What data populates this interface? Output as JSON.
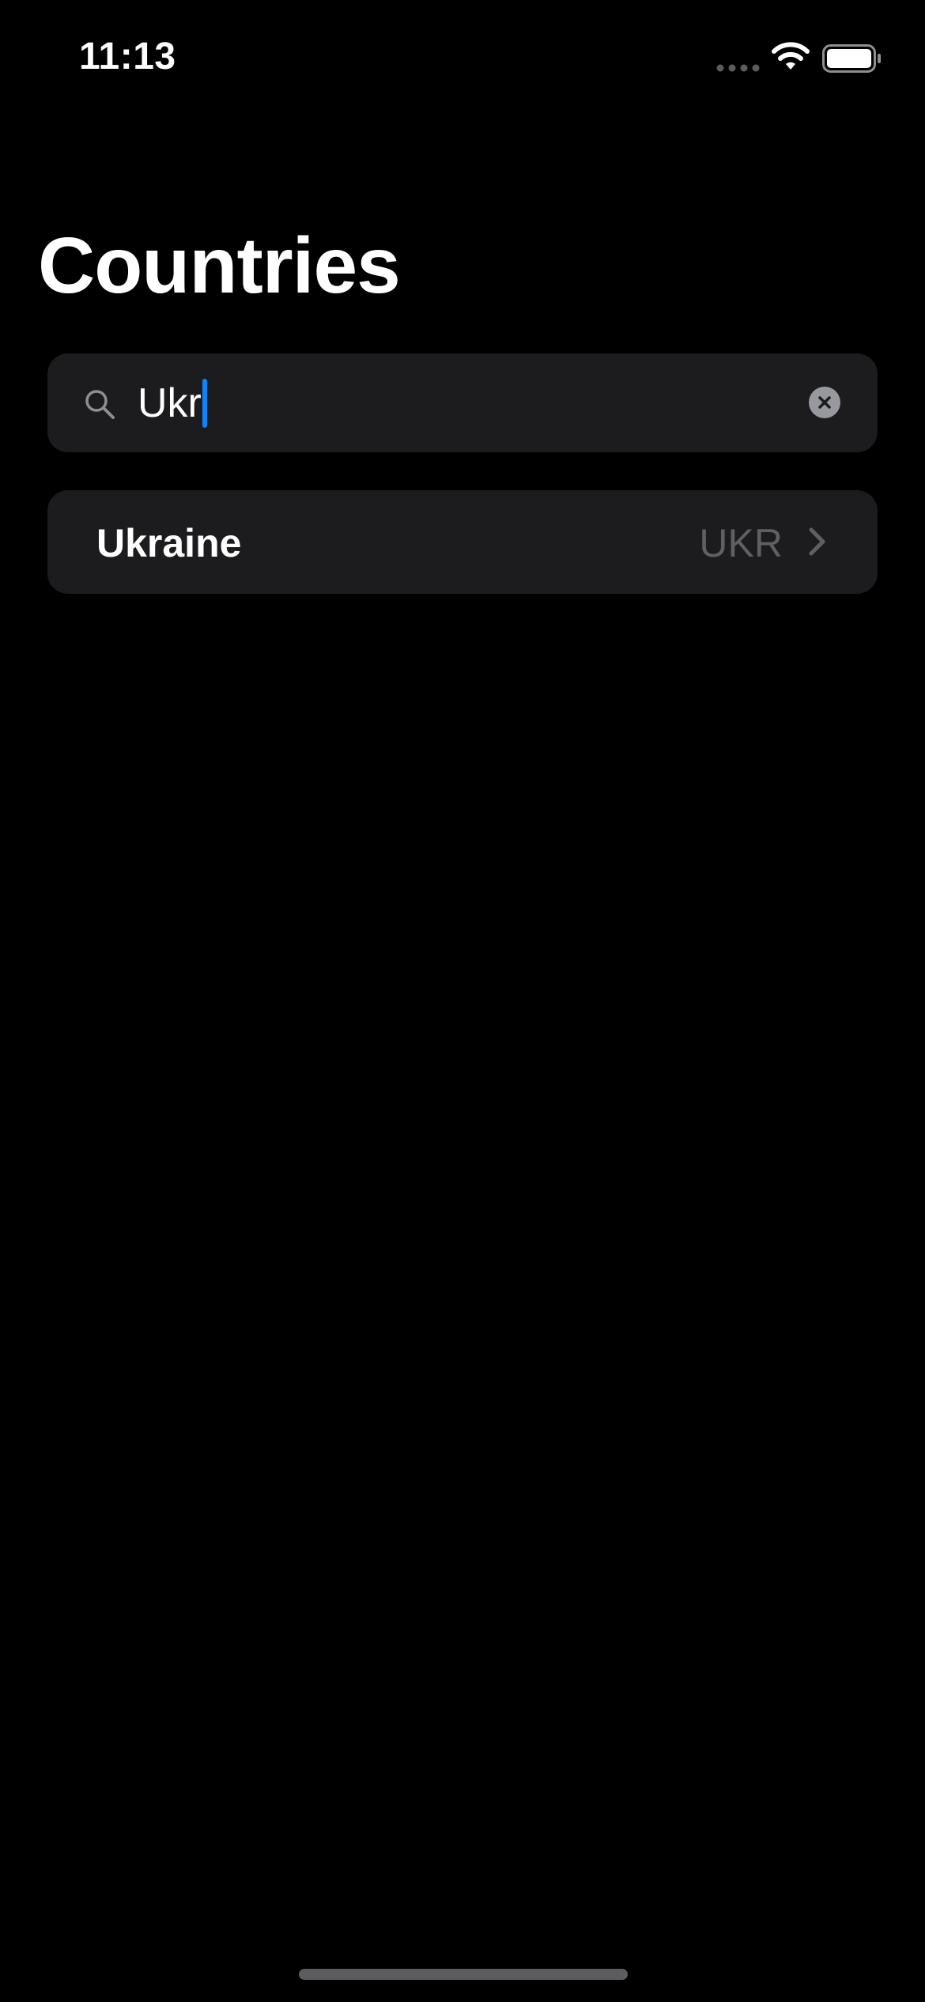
{
  "status_bar": {
    "time": "11:13",
    "icons": [
      "signal-dots-icon",
      "wifi-icon",
      "battery-icon"
    ]
  },
  "header": {
    "title": "Countries"
  },
  "search": {
    "value": "Ukr",
    "icon": "search-icon",
    "clear_icon": "clear-icon"
  },
  "results": [
    {
      "name": "Ukraine",
      "code": "UKR",
      "icon": "chevron-right-icon"
    }
  ],
  "colors": {
    "background": "#000000",
    "surface": "#1c1c1e",
    "accent": "#0a84ff",
    "secondary_text": "#5f5f64"
  }
}
